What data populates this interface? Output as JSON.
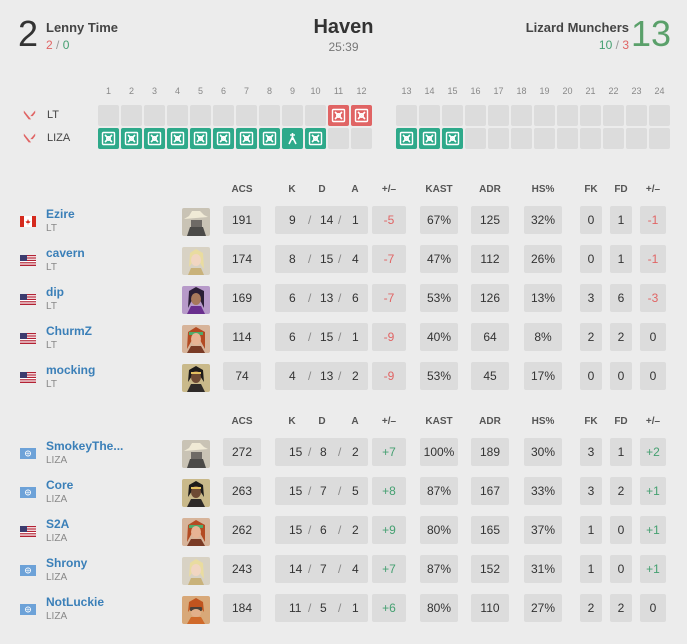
{
  "match": {
    "map": "Haven",
    "duration": "25:39"
  },
  "team1": {
    "name": "Lenny Time",
    "score": "2",
    "atk": "2",
    "def": "0",
    "abbr": "LT",
    "color": "#e06464"
  },
  "team2": {
    "name": "Lizard Munchers",
    "score": "13",
    "atk": "10",
    "def": "3",
    "abbr": "LIZA",
    "color": "#2ea98a"
  },
  "rounds": {
    "numbers": [
      "1",
      "2",
      "3",
      "4",
      "5",
      "6",
      "7",
      "8",
      "9",
      "10",
      "11",
      "12",
      "13",
      "14",
      "15",
      "16",
      "17",
      "18",
      "19",
      "20",
      "21",
      "22",
      "23",
      "24"
    ],
    "winner": [
      "LIZA",
      "LIZA",
      "LIZA",
      "LIZA",
      "LIZA",
      "LIZA",
      "LIZA",
      "LIZA",
      "LIZA",
      "LIZA",
      "LT",
      "LT",
      "LIZA",
      "LIZA",
      "LIZA",
      "",
      "",
      "",
      "",
      "",
      "",
      "",
      "",
      ""
    ],
    "win_type": [
      "elim",
      "elim",
      "elim",
      "elim",
      "elim",
      "elim",
      "elim",
      "elim",
      "defuse",
      "elim",
      "elim",
      "elim",
      "elim",
      "elim",
      "elim",
      "",
      "",
      "",
      "",
      "",
      "",
      "",
      "",
      ""
    ]
  },
  "columns": [
    "ACS",
    "K",
    "D",
    "A",
    "+/–",
    "KAST",
    "ADR",
    "HS%",
    "FK",
    "FD",
    "+/–"
  ],
  "kda_sep": "/",
  "teams": [
    {
      "players": [
        {
          "name": "Ezire",
          "team": "LT",
          "flag": "ca",
          "agent": "cowboy",
          "acs": "191",
          "k": "9",
          "d": "14",
          "a": "1",
          "pm": "-5",
          "kast": "67%",
          "adr": "125",
          "hs": "32%",
          "fk": "0",
          "fd": "1",
          "fpm": "-1"
        },
        {
          "name": "cavern",
          "team": "LT",
          "flag": "us",
          "agent": "blonde",
          "acs": "174",
          "k": "8",
          "d": "15",
          "a": "4",
          "pm": "-7",
          "kast": "47%",
          "adr": "112",
          "hs": "26%",
          "fk": "0",
          "fd": "1",
          "fpm": "-1"
        },
        {
          "name": "dip",
          "team": "LT",
          "flag": "us",
          "agent": "purple",
          "acs": "169",
          "k": "6",
          "d": "13",
          "a": "6",
          "pm": "-7",
          "kast": "53%",
          "adr": "126",
          "hs": "13%",
          "fk": "3",
          "fd": "6",
          "fpm": "-3"
        },
        {
          "name": "ChurmZ",
          "team": "LT",
          "flag": "us",
          "agent": "redhair",
          "acs": "114",
          "k": "6",
          "d": "15",
          "a": "1",
          "pm": "-9",
          "kast": "40%",
          "adr": "64",
          "hs": "8%",
          "fk": "2",
          "fd": "2",
          "fpm": "0"
        },
        {
          "name": "mocking",
          "team": "LT",
          "flag": "us",
          "agent": "dark",
          "acs": "74",
          "k": "4",
          "d": "13",
          "a": "2",
          "pm": "-9",
          "kast": "53%",
          "adr": "45",
          "hs": "17%",
          "fk": "0",
          "fd": "0",
          "fpm": "0"
        }
      ]
    },
    {
      "players": [
        {
          "name": "SmokeyThe...",
          "team": "LIZA",
          "flag": "un",
          "agent": "cowboy",
          "acs": "272",
          "k": "15",
          "d": "8",
          "a": "2",
          "pm": "+7",
          "kast": "100%",
          "adr": "189",
          "hs": "30%",
          "fk": "3",
          "fd": "1",
          "fpm": "+2"
        },
        {
          "name": "Core",
          "team": "LIZA",
          "flag": "un",
          "agent": "dark",
          "acs": "263",
          "k": "15",
          "d": "7",
          "a": "5",
          "pm": "+8",
          "kast": "87%",
          "adr": "167",
          "hs": "33%",
          "fk": "3",
          "fd": "2",
          "fpm": "+1"
        },
        {
          "name": "S2A",
          "team": "LIZA",
          "flag": "us",
          "agent": "redhair",
          "acs": "262",
          "k": "15",
          "d": "6",
          "a": "2",
          "pm": "+9",
          "kast": "80%",
          "adr": "165",
          "hs": "37%",
          "fk": "1",
          "fd": "0",
          "fpm": "+1"
        },
        {
          "name": "Shrony",
          "team": "LIZA",
          "flag": "un",
          "agent": "blonde",
          "acs": "243",
          "k": "14",
          "d": "7",
          "a": "4",
          "pm": "+7",
          "kast": "87%",
          "adr": "152",
          "hs": "31%",
          "fk": "1",
          "fd": "0",
          "fpm": "+1"
        },
        {
          "name": "NotLuckie",
          "team": "LIZA",
          "flag": "un",
          "agent": "orange",
          "acs": "184",
          "k": "11",
          "d": "5",
          "a": "1",
          "pm": "+6",
          "kast": "80%",
          "adr": "110",
          "hs": "27%",
          "fk": "2",
          "fd": "2",
          "fpm": "0"
        }
      ]
    }
  ]
}
